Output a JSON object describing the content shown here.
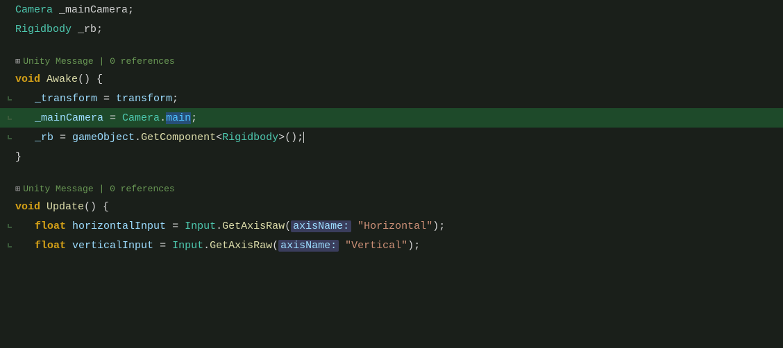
{
  "editor": {
    "background": "#1a1f1a",
    "lines": [
      {
        "id": "line1",
        "type": "code",
        "indent": 0,
        "tokens": [
          {
            "type": "kw-type",
            "text": "Camera"
          },
          {
            "type": "punc",
            "text": " _mainCamera;"
          }
        ]
      },
      {
        "id": "line2",
        "type": "code",
        "indent": 0,
        "tokens": [
          {
            "type": "kw-type",
            "text": "Rigidbody"
          },
          {
            "type": "punc",
            "text": " _rb;"
          }
        ]
      },
      {
        "id": "line3",
        "type": "blank"
      },
      {
        "id": "line4",
        "type": "meta",
        "icon": "⊞",
        "unity_message": "Unity Message",
        "separator": "|",
        "references": "0 references"
      },
      {
        "id": "line5",
        "type": "code",
        "indent": 0,
        "tokens": [
          {
            "type": "kw-void",
            "text": "void"
          },
          {
            "type": "punc",
            "text": " "
          },
          {
            "type": "fn-name",
            "text": "Awake"
          },
          {
            "type": "punc",
            "text": "() {"
          }
        ]
      },
      {
        "id": "line6",
        "type": "code",
        "indent": 1,
        "gutter": true,
        "tokens": [
          {
            "type": "var-name",
            "text": "_transform"
          },
          {
            "type": "punc",
            "text": " = "
          },
          {
            "type": "var-name",
            "text": "transform"
          },
          {
            "type": "punc",
            "text": ";"
          }
        ]
      },
      {
        "id": "line7",
        "type": "code",
        "indent": 1,
        "gutter": true,
        "highlighted": true,
        "tokens": [
          {
            "type": "var-name",
            "text": "_mainCamera"
          },
          {
            "type": "punc",
            "text": " = "
          },
          {
            "type": "cls-name",
            "text": "Camera"
          },
          {
            "type": "punc",
            "text": "."
          },
          {
            "type": "prop-selected",
            "text": "main"
          },
          {
            "type": "punc",
            "text": ";"
          }
        ]
      },
      {
        "id": "line8",
        "type": "code",
        "indent": 1,
        "gutter": true,
        "tokens": [
          {
            "type": "var-name",
            "text": "_rb"
          },
          {
            "type": "punc",
            "text": " = "
          },
          {
            "type": "var-name",
            "text": "gameObject"
          },
          {
            "type": "punc",
            "text": "."
          },
          {
            "type": "fn-name",
            "text": "GetComponent"
          },
          {
            "type": "punc",
            "text": "<"
          },
          {
            "type": "kw-type",
            "text": "Rigidbody"
          },
          {
            "type": "punc",
            "text": ">();"
          }
        ]
      },
      {
        "id": "line9",
        "type": "code",
        "indent": 0,
        "tokens": [
          {
            "type": "punc",
            "text": "}"
          }
        ]
      },
      {
        "id": "line10",
        "type": "blank"
      },
      {
        "id": "line11",
        "type": "meta",
        "icon": "⊞",
        "unity_message": "Unity Message",
        "separator": "|",
        "references": "0 references"
      },
      {
        "id": "line12",
        "type": "code",
        "indent": 0,
        "tokens": [
          {
            "type": "kw-void",
            "text": "void"
          },
          {
            "type": "punc",
            "text": " "
          },
          {
            "type": "fn-name",
            "text": "Update"
          },
          {
            "type": "punc",
            "text": "() {"
          }
        ]
      },
      {
        "id": "line13",
        "type": "code",
        "indent": 1,
        "gutter": true,
        "tokens": [
          {
            "type": "kw-void",
            "text": "float"
          },
          {
            "type": "punc",
            "text": " "
          },
          {
            "type": "var-name",
            "text": "horizontalInput"
          },
          {
            "type": "punc",
            "text": " = "
          },
          {
            "type": "cls-name",
            "text": "Input"
          },
          {
            "type": "punc",
            "text": "."
          },
          {
            "type": "fn-name",
            "text": "GetAxisRaw"
          },
          {
            "type": "punc",
            "text": "("
          },
          {
            "type": "param-label",
            "text": "axisName:"
          },
          {
            "type": "punc",
            "text": " "
          },
          {
            "type": "string",
            "text": "\"Horizontal\""
          },
          {
            "type": "punc",
            "text": ");"
          }
        ]
      },
      {
        "id": "line14",
        "type": "code",
        "indent": 1,
        "gutter": true,
        "tokens": [
          {
            "type": "kw-void",
            "text": "float"
          },
          {
            "type": "punc",
            "text": " "
          },
          {
            "type": "var-name",
            "text": "verticalInput"
          },
          {
            "type": "punc",
            "text": " = "
          },
          {
            "type": "cls-name",
            "text": "Input"
          },
          {
            "type": "punc",
            "text": "."
          },
          {
            "type": "fn-name",
            "text": "GetAxisRaw"
          },
          {
            "type": "punc",
            "text": "("
          },
          {
            "type": "param-label",
            "text": "axisName:"
          },
          {
            "type": "punc",
            "text": " "
          },
          {
            "type": "string",
            "text": "\"Vertical\""
          },
          {
            "type": "punc",
            "text": ");"
          }
        ]
      }
    ]
  }
}
